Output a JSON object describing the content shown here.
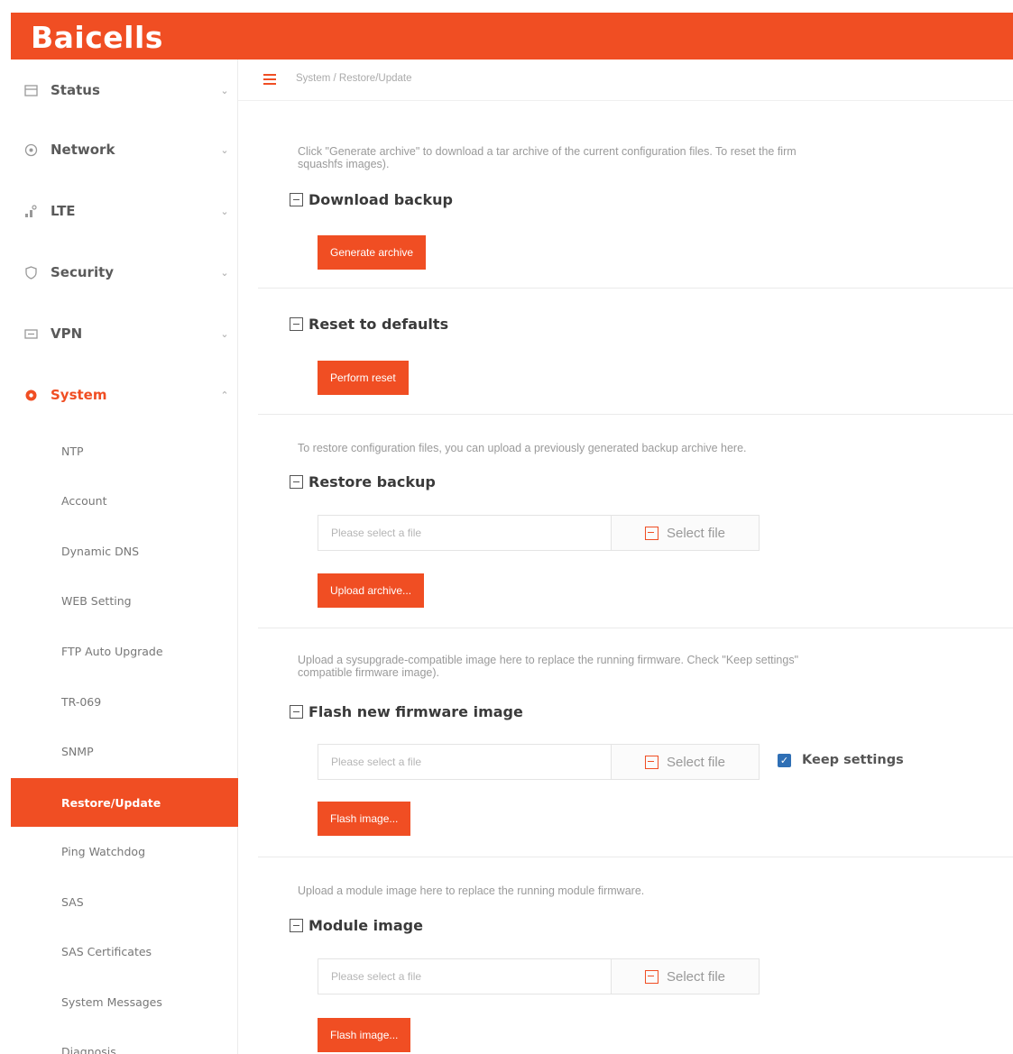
{
  "brand": {
    "logo": "Baicells",
    "accent": "#f04e23"
  },
  "sidebar": {
    "top_items": [
      {
        "label": "Status",
        "icon": "status-icon"
      },
      {
        "label": "Network",
        "icon": "network-icon"
      },
      {
        "label": "LTE",
        "icon": "lte-icon"
      },
      {
        "label": "Security",
        "icon": "shield-icon"
      },
      {
        "label": "VPN",
        "icon": "vpn-icon"
      },
      {
        "label": "System",
        "icon": "gear-icon"
      }
    ],
    "chevron_down": "⌄",
    "chevron_up": "⌃",
    "sub_items": [
      "NTP",
      "Account",
      "Dynamic DNS",
      "WEB Setting",
      "FTP Auto Upgrade",
      "TR-069",
      "SNMP",
      "Restore/Update",
      "Ping Watchdog",
      "SAS",
      "SAS Certificates",
      "System Messages",
      "Diagnosis"
    ],
    "active_sub": "Restore/Update"
  },
  "breadcrumb": "System / Restore/Update",
  "sections": {
    "download": {
      "desc_line1": "Click \"Generate archive\" to download a tar archive of the current configuration files. To reset the firm",
      "desc_line2": "squashfs images).",
      "title": "Download backup",
      "button": "Generate archive"
    },
    "reset": {
      "title": "Reset to defaults",
      "button": "Perform reset"
    },
    "restore": {
      "desc": "To restore configuration files, you can upload a previously generated backup archive here.",
      "title": "Restore backup",
      "placeholder": "Please select a file",
      "select": "Select file",
      "button": "Upload archive..."
    },
    "flash": {
      "desc_line1": "Upload a sysupgrade-compatible image here to replace the running firmware. Check \"Keep settings\"",
      "desc_line2": "compatible firmware image).",
      "title": "Flash new firmware image",
      "placeholder": "Please select a file",
      "select": "Select file",
      "keep": "Keep settings",
      "button": "Flash image..."
    },
    "module": {
      "desc": "Upload a module image here to replace the running module firmware.",
      "title": "Module image",
      "placeholder": "Please select a file",
      "select": "Select file",
      "button": "Flash image..."
    }
  }
}
